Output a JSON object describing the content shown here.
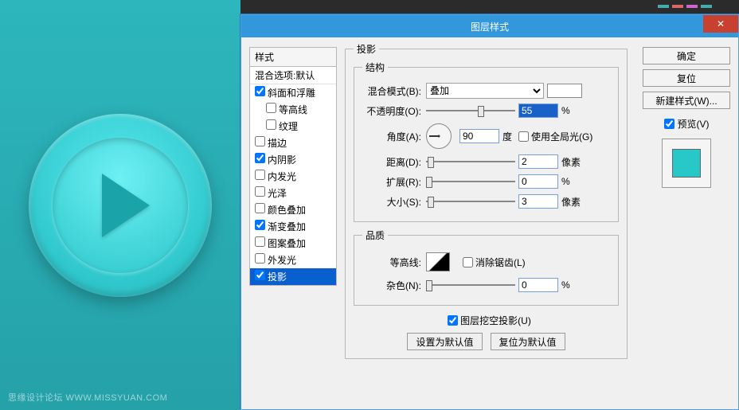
{
  "watermark": "思缘设计论坛  WWW.MISSYUAN.COM",
  "dialog": {
    "title": "图层样式",
    "close": "✕",
    "styles_header": "样式",
    "blend_default": "混合选项:默认",
    "items": {
      "bevel": "斜面和浮雕",
      "contour": "等高线",
      "texture": "纹理",
      "stroke": "描边",
      "inner_shadow": "内阴影",
      "inner_glow": "内发光",
      "satin": "光泽",
      "color_overlay": "颜色叠加",
      "gradient_overlay": "渐变叠加",
      "pattern_overlay": "图案叠加",
      "outer_glow": "外发光",
      "drop_shadow": "投影"
    },
    "panel": {
      "title": "投影",
      "structure": "结构",
      "blend_mode_label": "混合模式(B):",
      "blend_mode_value": "叠加",
      "opacity_label": "不透明度(O):",
      "opacity_value": "55",
      "percent": "%",
      "angle_label": "角度(A):",
      "angle_value": "90",
      "degree": "度",
      "global_light": "使用全局光(G)",
      "distance_label": "距离(D):",
      "distance_value": "2",
      "px": "像素",
      "spread_label": "扩展(R):",
      "spread_value": "0",
      "size_label": "大小(S):",
      "size_value": "3",
      "quality": "品质",
      "contour_label": "等高线:",
      "antialias": "消除锯齿(L)",
      "noise_label": "杂色(N):",
      "noise_value": "0",
      "knockout": "图层挖空投影(U)",
      "make_default": "设置为默认值",
      "reset_default": "复位为默认值"
    },
    "buttons": {
      "ok": "确定",
      "cancel": "复位",
      "new_style": "新建样式(W)...",
      "preview": "预览(V)"
    }
  }
}
